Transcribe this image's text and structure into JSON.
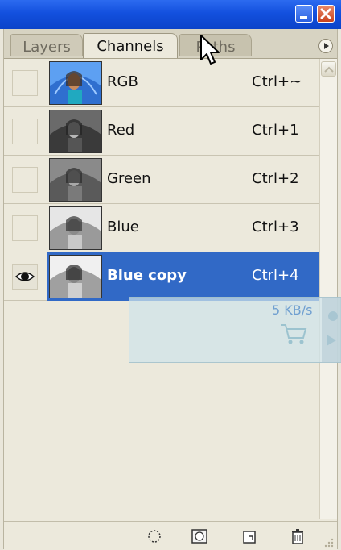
{
  "window": {
    "minimize_icon": "minimize-icon",
    "close_icon": "close-icon"
  },
  "tabs": [
    {
      "label": "Layers"
    },
    {
      "label": "Channels"
    },
    {
      "label": "Paths"
    }
  ],
  "channels": [
    {
      "name": "RGB",
      "shortcut": "Ctrl+~",
      "visible": false,
      "selected": false
    },
    {
      "name": "Red",
      "shortcut": "Ctrl+1",
      "visible": false,
      "selected": false
    },
    {
      "name": "Green",
      "shortcut": "Ctrl+2",
      "visible": false,
      "selected": false
    },
    {
      "name": "Blue",
      "shortcut": "Ctrl+3",
      "visible": false,
      "selected": false
    },
    {
      "name": "Blue copy",
      "shortcut": "Ctrl+4",
      "visible": true,
      "selected": true
    }
  ],
  "overlay": {
    "speed": "5 KB/s"
  },
  "colors": {
    "selection": "#3169c6",
    "titlebar": "#0b43c9"
  }
}
